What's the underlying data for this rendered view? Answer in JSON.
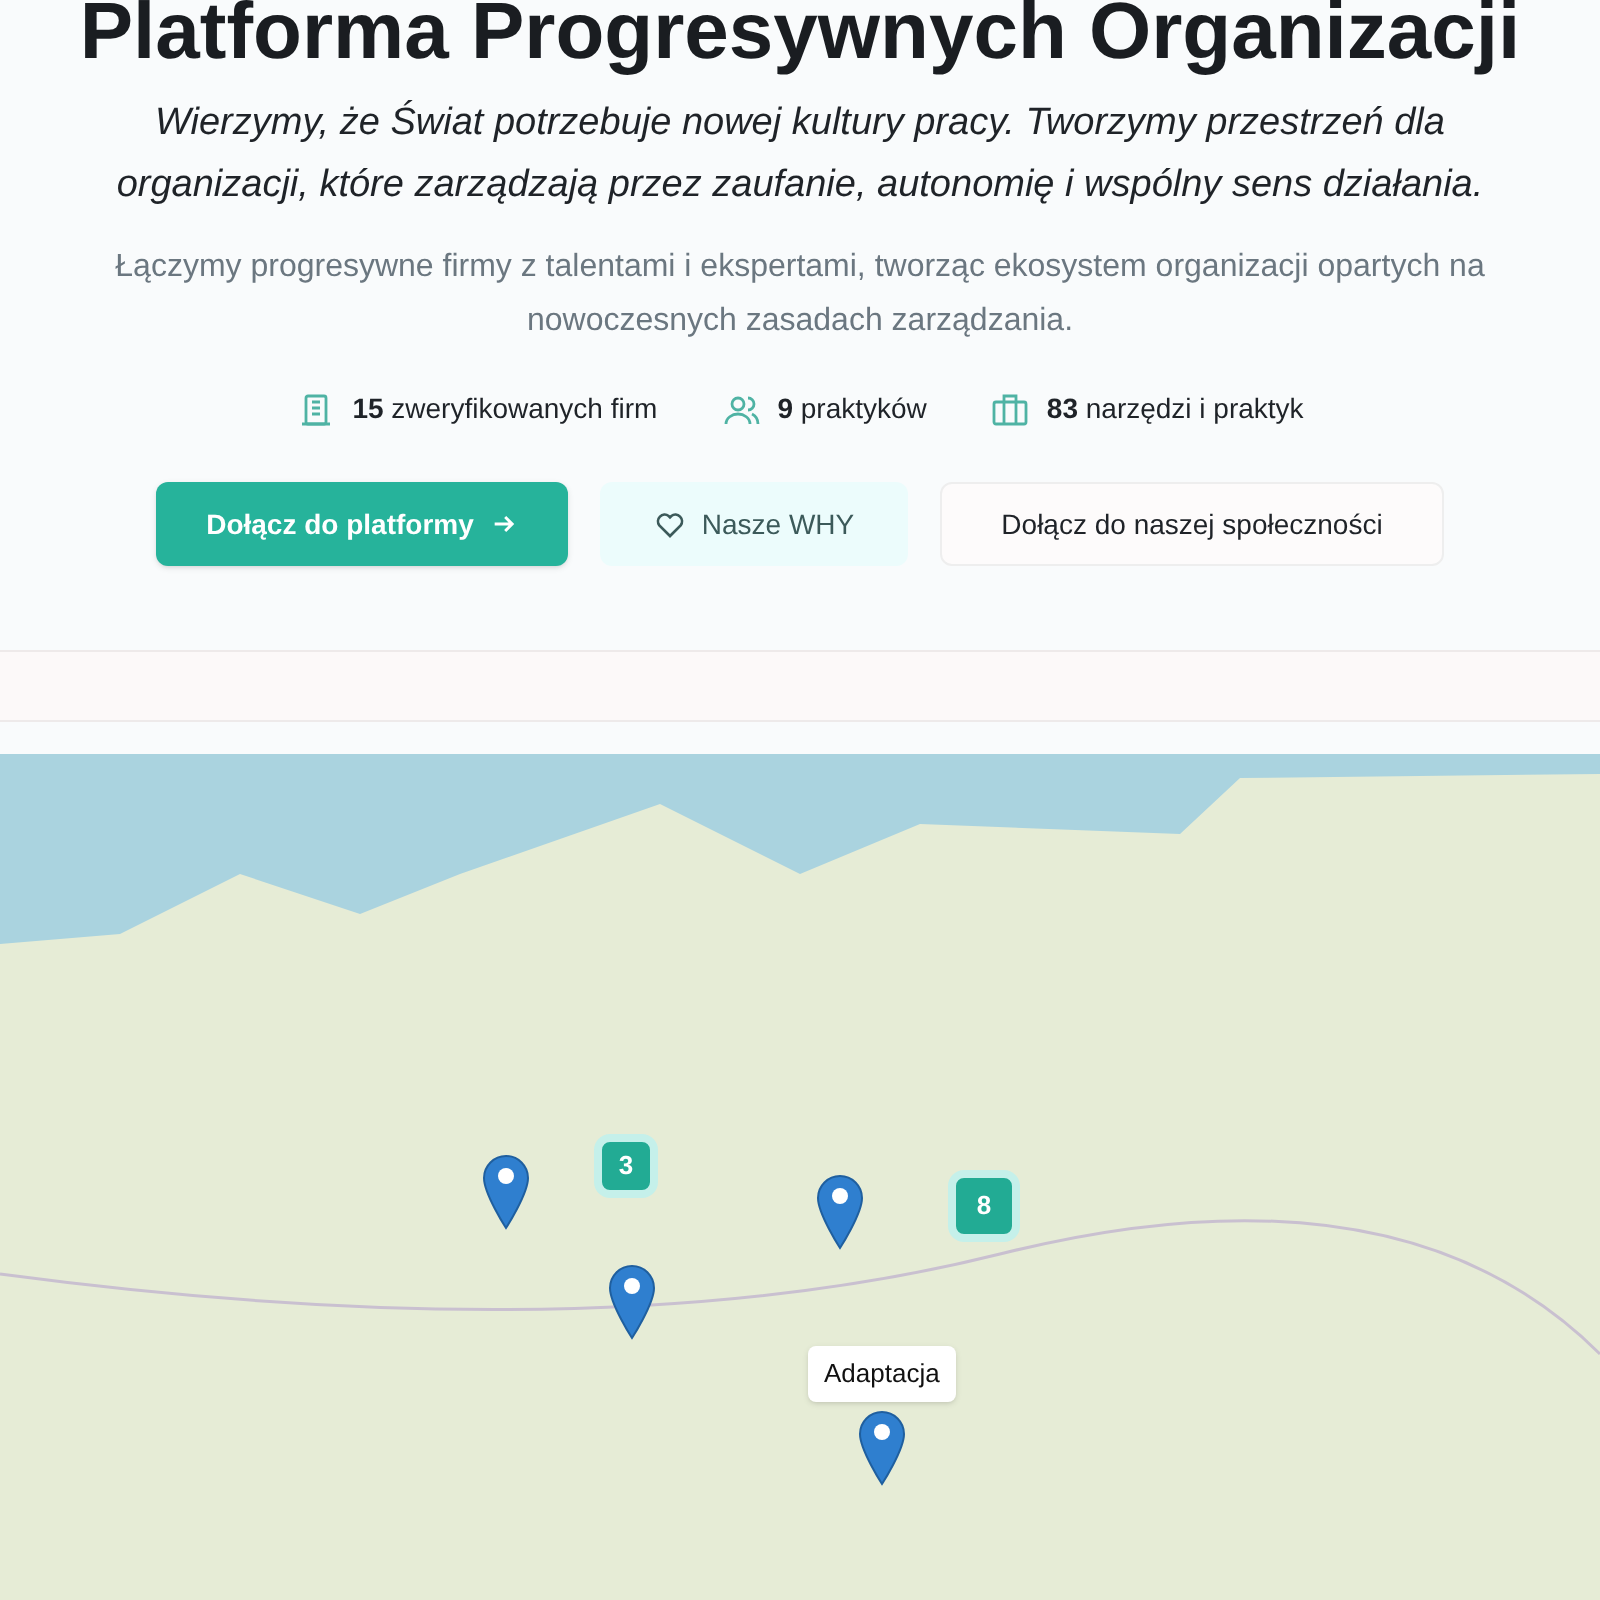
{
  "hero": {
    "title": "Platforma Progresywnych Organizacji",
    "tagline": "Wierzymy, że Świat potrzebuje nowej kultury pracy. Tworzymy przestrzeń dla organizacji, które zarządzają przez zaufanie, autonomię i wspólny sens działania.",
    "description": "Łączymy progresywne firmy z talentami i ekspertami, tworząc ekosystem organizacji opartych na nowoczesnych zasadach zarządzania.",
    "stats": [
      {
        "kind": "companies",
        "count": "15",
        "label": "zweryfikowanych firm"
      },
      {
        "kind": "people",
        "count": "9",
        "label": "praktyków"
      },
      {
        "kind": "tools",
        "count": "83",
        "label": "narzędzi i praktyk"
      }
    ],
    "buttons": [
      {
        "kind": "primary",
        "label": "Dołącz do platformy"
      },
      {
        "kind": "soft",
        "label": "Nasze WHY"
      },
      {
        "kind": "outline",
        "label": "Dołącz do naszej społeczności"
      }
    ]
  },
  "map": {
    "markers": [
      {
        "kind": "pin"
      },
      {
        "kind": "cluster",
        "label": "3"
      },
      {
        "kind": "pin"
      },
      {
        "kind": "cluster",
        "label": "8"
      },
      {
        "kind": "pin"
      },
      {
        "kind": "pin",
        "tooltip": "Adaptacja"
      }
    ]
  }
}
